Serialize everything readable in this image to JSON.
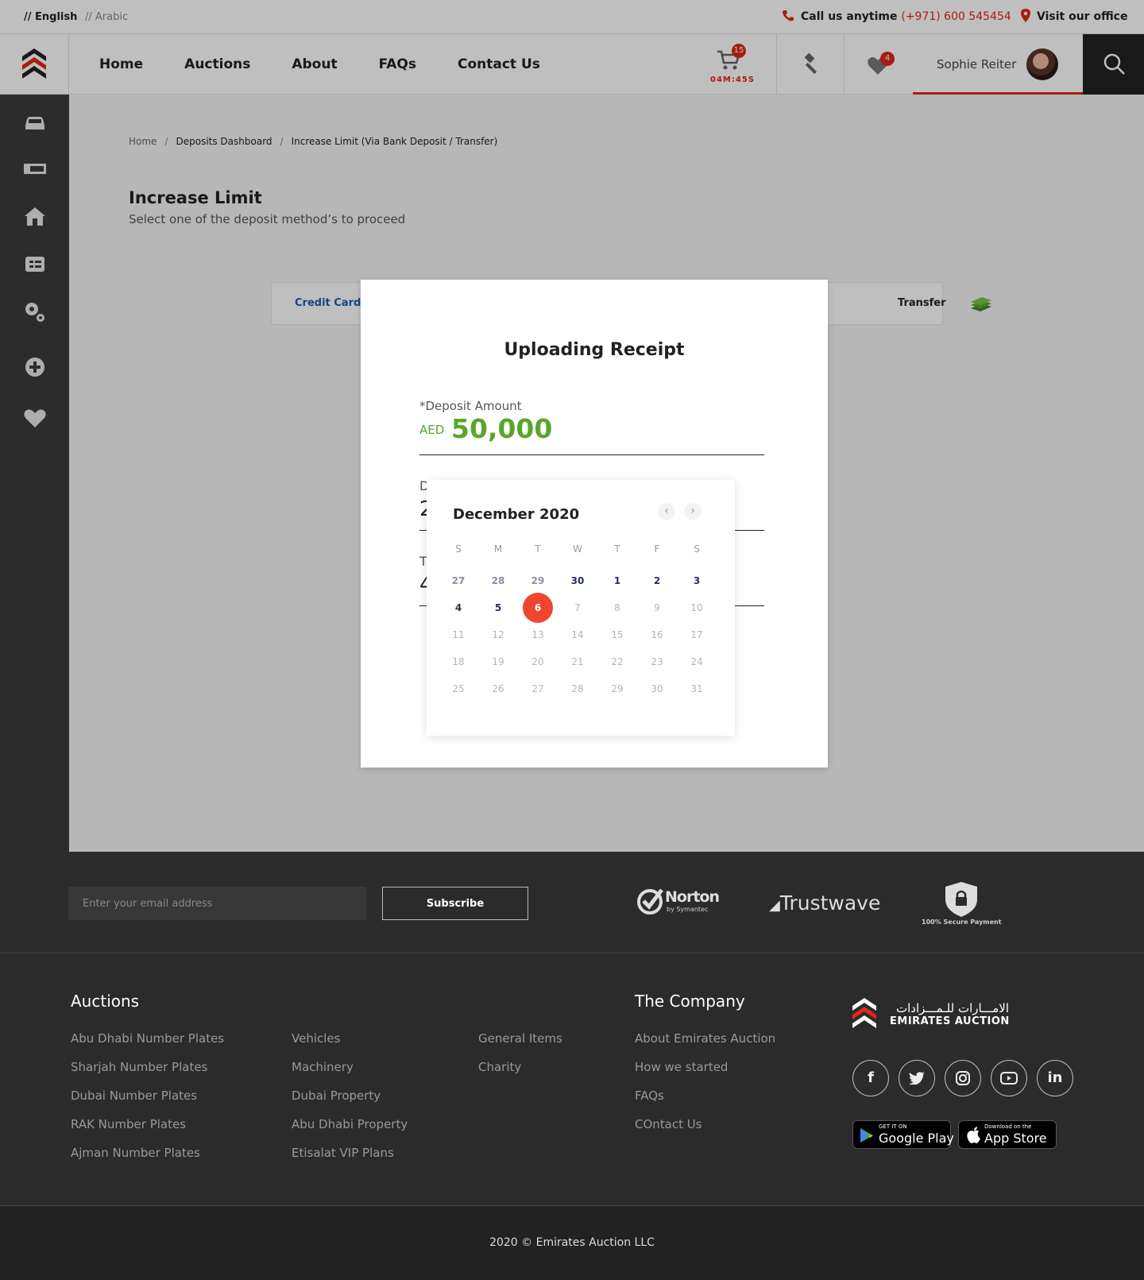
{
  "topbar": {
    "lang_en": "// English",
    "lang_ar": "// Arabic",
    "call_label": "Call us anytime",
    "call_number": "(+971) 600 545454",
    "visit_label": "Visit our office"
  },
  "nav": {
    "menu": [
      "Home",
      "Auctions",
      "About",
      "FAQs",
      "Contact Us"
    ],
    "cart_count": "15",
    "timer": "04M:45S",
    "favorites_count": "4",
    "user_name": "Sophie Reiter"
  },
  "breadcrumb": [
    "Home",
    "Deposits Dashboard",
    "Increase Limit (Via Bank Deposit / Transfer)"
  ],
  "page": {
    "title": "Increase Limit",
    "subtitle": "Select one of the deposit method’s to proceed",
    "option_credit": "Credit Card",
    "option_transfer": "Transfer"
  },
  "modal": {
    "title": "Uploading Receipt",
    "amount_label": "*Deposit Amount",
    "currency": "AED",
    "amount": "50,000",
    "field2_label_partial": "D",
    "field2_value_partial": "2",
    "field3_label_partial": "T",
    "field3_value_partial": "4"
  },
  "calendar": {
    "month_label": "December 2020",
    "weekdays": [
      "S",
      "M",
      "T",
      "W",
      "T",
      "F",
      "S"
    ],
    "weeks": [
      [
        "27",
        "28",
        "29",
        "30",
        "1",
        "2",
        "3"
      ],
      [
        "4",
        "5",
        "6",
        "7",
        "8",
        "9",
        "10"
      ],
      [
        "11",
        "12",
        "13",
        "14",
        "15",
        "16",
        "17"
      ],
      [
        "18",
        "19",
        "20",
        "21",
        "22",
        "23",
        "24"
      ],
      [
        "25",
        "26",
        "27",
        "28",
        "29",
        "30",
        "31"
      ]
    ],
    "selected_day": "6"
  },
  "footer": {
    "email_placeholder": "Enter your email address",
    "subscribe": "Subscribe",
    "norton": "Norton",
    "norton_sub": "by Symantec",
    "trustwave": "Trustwave",
    "secure_payment": "100% Secure Payment",
    "auctions_heading": "Auctions",
    "auctions_col1": [
      "Abu Dhabi Number Plates",
      "Sharjah Number Plates",
      "Dubai Number Plates",
      "RAK Number Plates",
      "Ajman Number Plates"
    ],
    "auctions_col2": [
      "Vehicles",
      "Machinery",
      "Dubai Property",
      "Abu Dhabi Property",
      "Etisalat VIP Plans"
    ],
    "auctions_col3": [
      "General Items",
      "Charity"
    ],
    "company_heading": "The Company",
    "company_links": [
      "About Emirates Auction",
      "How we started",
      "FAQs",
      "COntact Us"
    ],
    "brand_ar": "الامـــارات للـمـــزادات",
    "brand_en": "EMIRATES AUCTION",
    "social": [
      "facebook-icon",
      "twitter-icon",
      "instagram-icon",
      "youtube-icon",
      "linkedin-icon"
    ],
    "google_play_small": "GET IT ON",
    "google_play": "Google Play",
    "app_store_small": "Download on the",
    "app_store": "App Store",
    "copyright": "2020 © Emirates Auction LLC"
  }
}
